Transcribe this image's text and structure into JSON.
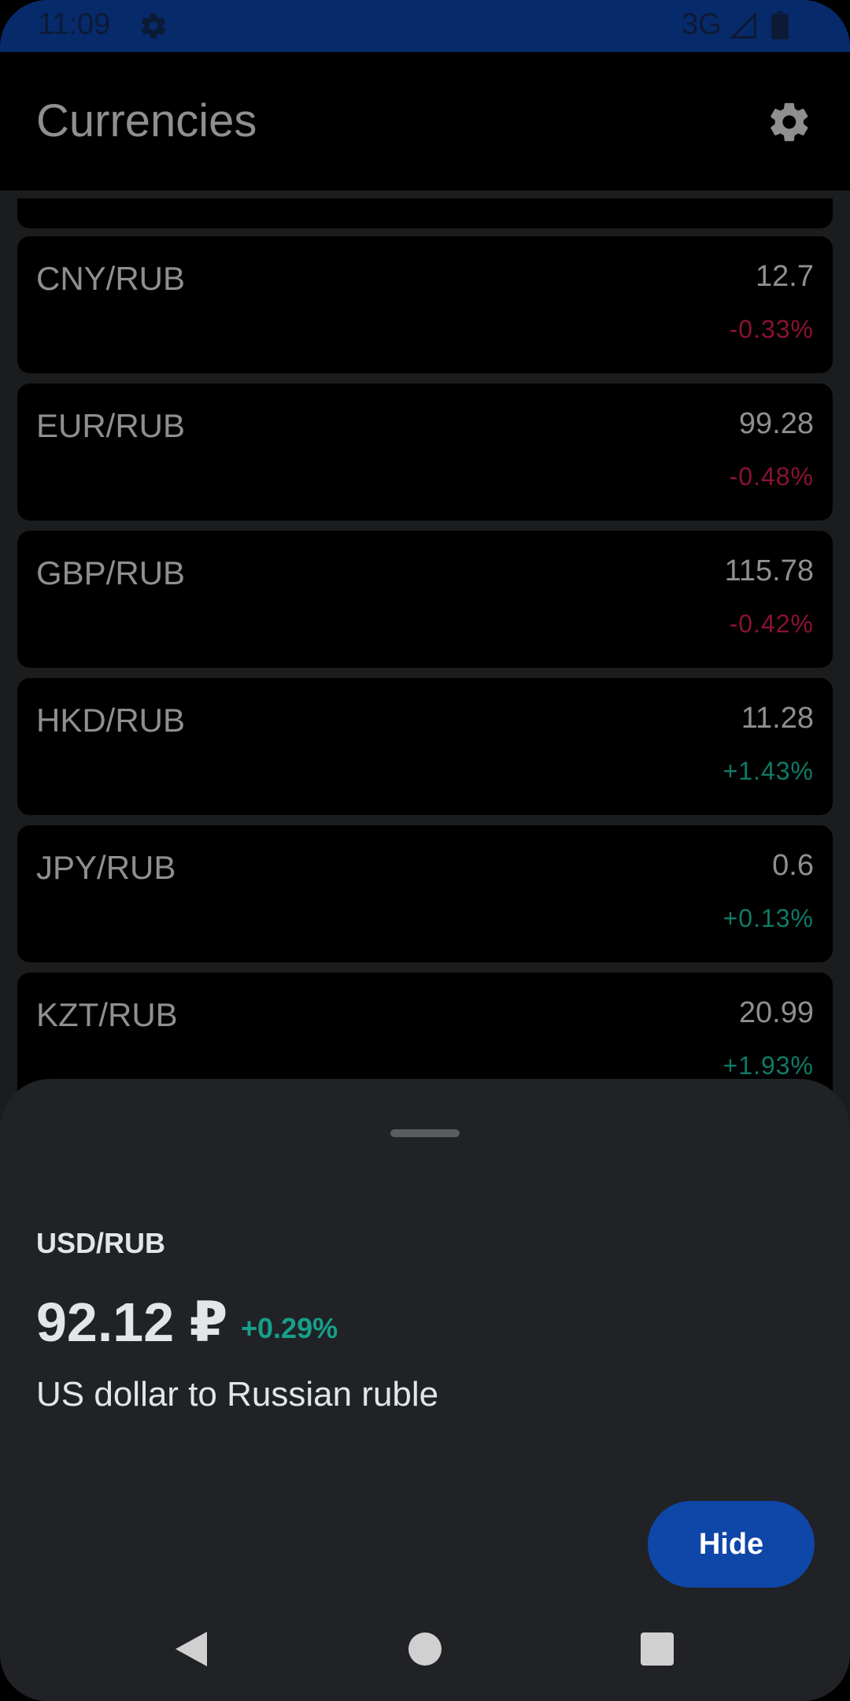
{
  "status_bar": {
    "time": "11:09",
    "network": "3G",
    "icons": [
      "gear-icon",
      "signal-icon",
      "battery-icon"
    ]
  },
  "app_bar": {
    "title": "Currencies",
    "settings_icon": "gear-icon"
  },
  "currencies": [
    {
      "pair": "CNY/RUB",
      "value": "12.7",
      "change": "-0.33%",
      "trend": "negative"
    },
    {
      "pair": "EUR/RUB",
      "value": "99.28",
      "change": "-0.48%",
      "trend": "negative"
    },
    {
      "pair": "GBP/RUB",
      "value": "115.78",
      "change": "-0.42%",
      "trend": "negative"
    },
    {
      "pair": "HKD/RUB",
      "value": "11.28",
      "change": "+1.43%",
      "trend": "positive"
    },
    {
      "pair": "JPY/RUB",
      "value": "0.6",
      "change": "+0.13%",
      "trend": "positive"
    },
    {
      "pair": "KZT/RUB",
      "value": "20.99",
      "change": "+1.93%",
      "trend": "positive"
    }
  ],
  "bottom_sheet": {
    "pair": "USD/RUB",
    "rate": "92.12 ₽",
    "change": "+0.29%",
    "description": "US dollar to Russian ruble",
    "hide_label": "Hide"
  },
  "colors": {
    "status_bar": "#072a6b",
    "negative": "#8a1233",
    "positive": "#0f7a68",
    "sheet_change": "#16a08a",
    "hide_button": "#0f47a8"
  },
  "nav_bar": {
    "icons": [
      "back-icon",
      "home-icon",
      "recents-icon"
    ]
  }
}
